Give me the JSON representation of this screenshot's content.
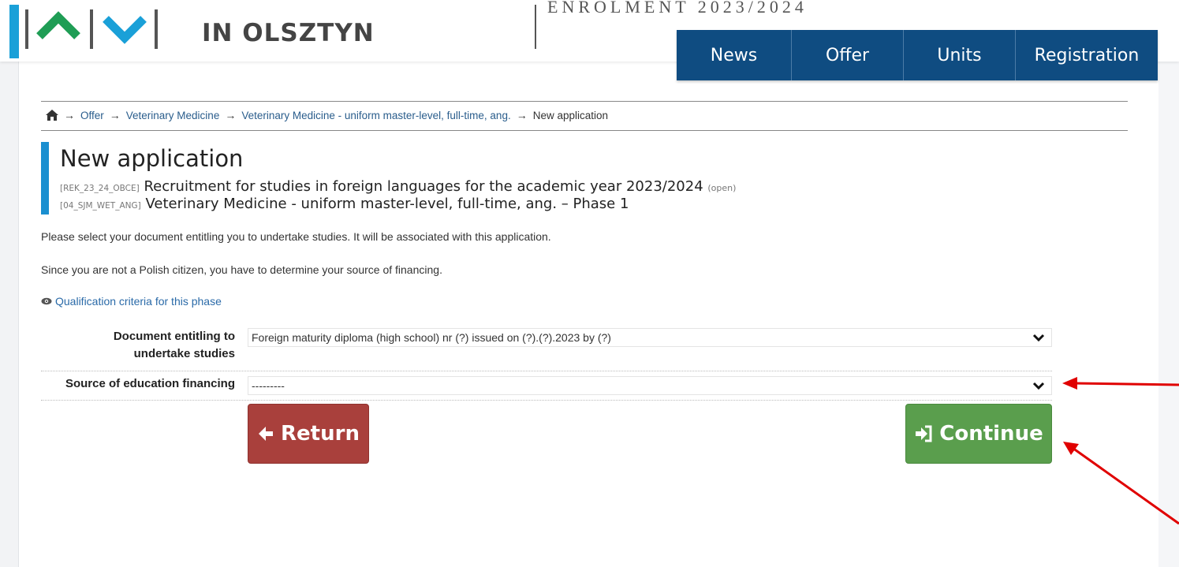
{
  "header": {
    "university_name": "IN OLSZTYN",
    "enrolment_label": "ENROLMENT 2023/2024",
    "colors": {
      "nav_bg": "#0f4c81",
      "logo_green": "#1f9d55",
      "logo_blue": "#1aa0d8"
    }
  },
  "nav": {
    "items": [
      {
        "label": "News"
      },
      {
        "label": "Offer"
      },
      {
        "label": "Units"
      },
      {
        "label": "Registration"
      }
    ]
  },
  "breadcrumb": {
    "home_icon": "home-icon",
    "items": [
      {
        "label": "Offer"
      },
      {
        "label": "Veterinary Medicine"
      },
      {
        "label": "Veterinary Medicine - uniform master-level, full-time, ang."
      },
      {
        "label": "New application"
      }
    ]
  },
  "page": {
    "title": "New application",
    "recruitment_code": "[REK_23_24_OBCE]",
    "recruitment_name": "Recruitment for studies in foreign languages for the academic year 2023/2024",
    "recruitment_status": "(open)",
    "program_code": "[04_SJM_WET_ANG]",
    "program_name": "Veterinary Medicine - uniform master-level, full-time, ang. – Phase 1",
    "instruction_1": "Please select your document entitling you to undertake studies. It will be associated with this application.",
    "instruction_2": "Since you are not a Polish citizen, you have to determine your source of financing.",
    "criteria_link": "Qualification criteria for this phase"
  },
  "form": {
    "document_label_line1": "Document entitling to",
    "document_label_line2": "undertake studies",
    "document_value": "Foreign maturity diploma (high school) nr (?) issued on (?).(?).2023 by (?)",
    "financing_label": "Source of education financing",
    "financing_value": "---------"
  },
  "buttons": {
    "return_label": "Return",
    "continue_label": "Continue",
    "colors": {
      "return": "#a9403c",
      "continue": "#5a9e4d"
    }
  },
  "annotations": {
    "arrow_color": "#e00000"
  }
}
